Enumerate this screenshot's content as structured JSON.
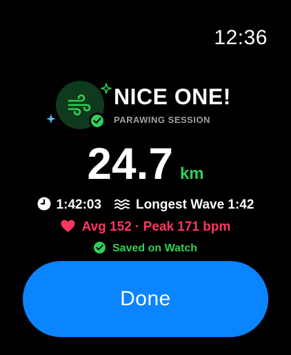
{
  "status_bar": {
    "time": "12:36"
  },
  "header": {
    "title": "NICE ONE!",
    "subtitle": "PARAWING SESSION",
    "badge_icon": "wind-icon",
    "badge_status_icon": "checkmark-icon",
    "sparkle_colors": [
      "#2ed158",
      "#5ac8fa"
    ]
  },
  "metrics": {
    "distance_value": "24.7",
    "distance_unit": "km",
    "duration": "1:42:03",
    "longest_wave": "Longest Wave 1:42",
    "heart_rate": "Avg 152 · Peak 171 bpm",
    "saved_status": "Saved on Watch"
  },
  "icons": {
    "duration": "clock-icon",
    "wave": "waves-icon",
    "heart": "heart-icon",
    "saved": "checkmark-circle-icon"
  },
  "actions": {
    "done_label": "Done"
  },
  "colors": {
    "accent_green": "#2ed158",
    "button_blue": "#0a84ff",
    "heart_pink": "#ff375f",
    "badge_bg": "#0f3a1d",
    "subtitle_gray": "#a0a0a5"
  }
}
